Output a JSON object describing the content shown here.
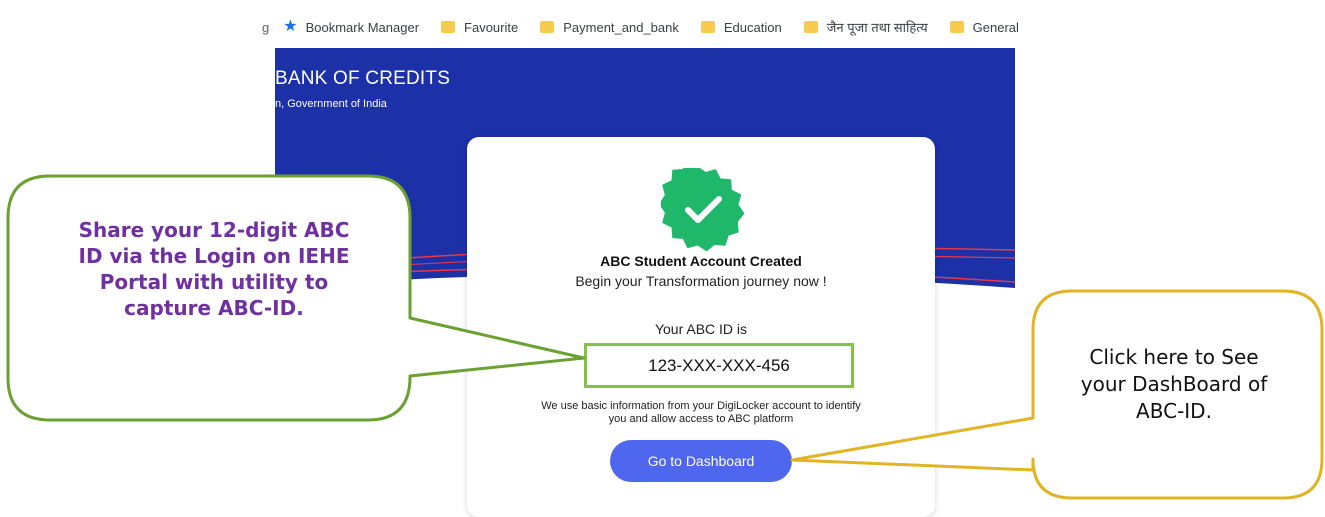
{
  "bookmarks": {
    "cut_item": "g",
    "items": [
      {
        "label": "Bookmark Manager",
        "icon": "star-icon"
      },
      {
        "label": "Favourite",
        "icon": "folder-icon"
      },
      {
        "label": "Payment_and_bank",
        "icon": "folder-icon"
      },
      {
        "label": "Education",
        "icon": "folder-icon"
      },
      {
        "label": "जैन पूजा तथा साहित्य",
        "icon": "folder-icon"
      },
      {
        "label": "General",
        "icon": "folder-icon"
      }
    ]
  },
  "banner": {
    "title": "BANK OF CREDITS",
    "subtitle": "n, Government of India",
    "background_color": "#1c31a8"
  },
  "card": {
    "badge_icon": "verified-check-badge-icon",
    "badge_color": "#1fb86b",
    "title": "ABC Student Account Created",
    "subtitle": "Begin your Transformation journey now !",
    "abc_id_label": "Your ABC ID is",
    "abc_id_value": "123-XXX-XXX-456",
    "info_line1": "We use basic information from your DigiLocker account to identify",
    "info_line2": "you and allow access to ABC platform",
    "dashboard_button": "Go to Dashboard",
    "button_color": "#4f67ee"
  },
  "callouts": {
    "left": {
      "line1": "Share your 12-digit ABC",
      "line2": "ID via the Login on IEHE",
      "line3": "Portal with utility to",
      "line4": "capture ABC-ID.",
      "border_color": "#6aa130",
      "text_color": "#7030a0"
    },
    "right": {
      "line1": "Click here to See",
      "line2": "your DashBoard of",
      "line3": "ABC-ID.",
      "border_color": "#e0b423"
    }
  }
}
